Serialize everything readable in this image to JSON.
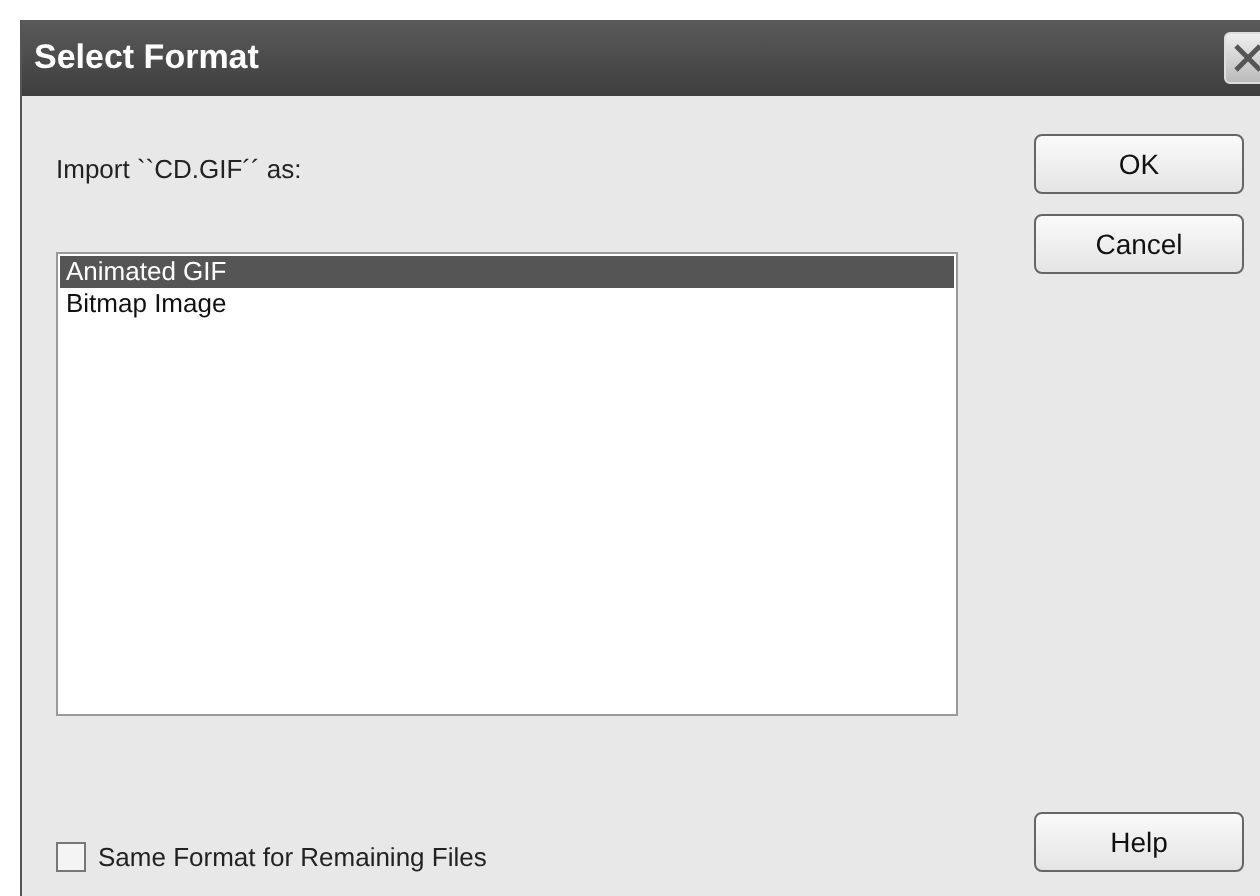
{
  "window": {
    "title": "Select Format"
  },
  "prompt": "Import ``CD.GIF´´ as:",
  "formats": [
    {
      "label": "Animated GIF",
      "selected": true
    },
    {
      "label": "Bitmap Image",
      "selected": false
    }
  ],
  "option": {
    "label": "Same Format for Remaining Files",
    "checked": false
  },
  "buttons": [
    {
      "label": "OK"
    },
    {
      "label": "Cancel"
    }
  ],
  "help_button": {
    "label": "Help"
  }
}
